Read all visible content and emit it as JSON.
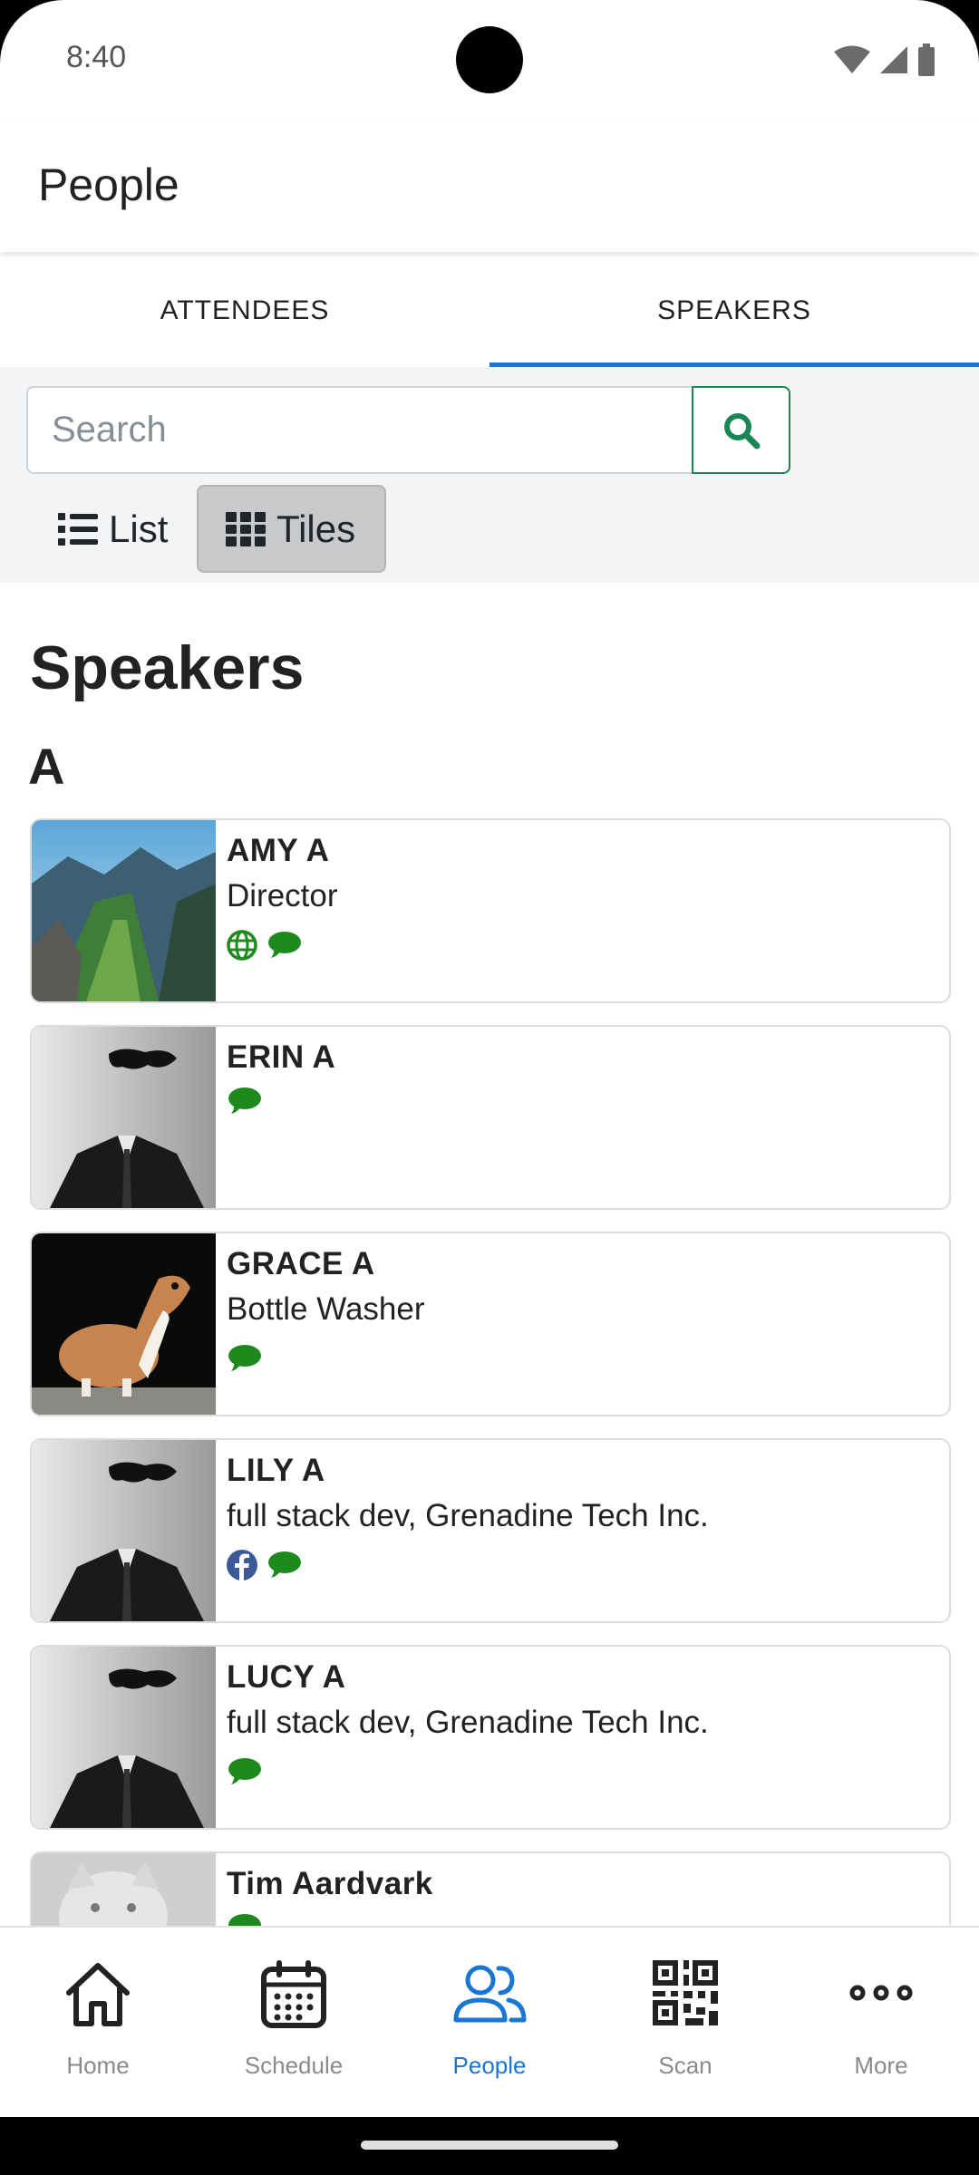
{
  "status_bar": {
    "time": "8:40"
  },
  "app_bar": {
    "title": "People"
  },
  "tabs": [
    {
      "label": "ATTENDEES",
      "active": false
    },
    {
      "label": "SPEAKERS",
      "active": true
    }
  ],
  "search": {
    "placeholder": "Search",
    "value": ""
  },
  "view_toggle": {
    "list_label": "List",
    "tiles_label": "Tiles",
    "selected": "Tiles"
  },
  "content": {
    "heading": "Speakers",
    "section_letter": "A"
  },
  "speakers": [
    {
      "name": "AMY A",
      "role": "Director",
      "icons": [
        "globe-icon",
        "chat-icon"
      ],
      "photo": "mountain-fjord"
    },
    {
      "name": "ERIN A",
      "role": "",
      "icons": [
        "chat-icon"
      ],
      "photo": "invisible-man"
    },
    {
      "name": "GRACE A",
      "role": "Bottle Washer",
      "icons": [
        "chat-icon"
      ],
      "photo": "weasel"
    },
    {
      "name": "LILY A",
      "role": "full stack dev, Grenadine Tech Inc.",
      "icons": [
        "facebook-icon",
        "chat-icon"
      ],
      "photo": "invisible-man"
    },
    {
      "name": "LUCY A",
      "role": "full stack dev, Grenadine Tech Inc.",
      "icons": [
        "chat-icon"
      ],
      "photo": "invisible-man"
    },
    {
      "name": "Tim Aardvark",
      "role": "",
      "icons": [
        "chat-icon"
      ],
      "photo": "cat"
    }
  ],
  "bottom_nav": [
    {
      "label": "Home",
      "icon": "home-icon"
    },
    {
      "label": "Schedule",
      "icon": "calendar-icon"
    },
    {
      "label": "People",
      "icon": "people-icon",
      "active": true
    },
    {
      "label": "Scan",
      "icon": "qr-code-icon"
    },
    {
      "label": "More",
      "icon": "more-icon"
    }
  ],
  "colors": {
    "accent": "#1976d2",
    "success": "#198754",
    "icon_green": "#1e8a1e",
    "facebook": "#3b5998"
  }
}
